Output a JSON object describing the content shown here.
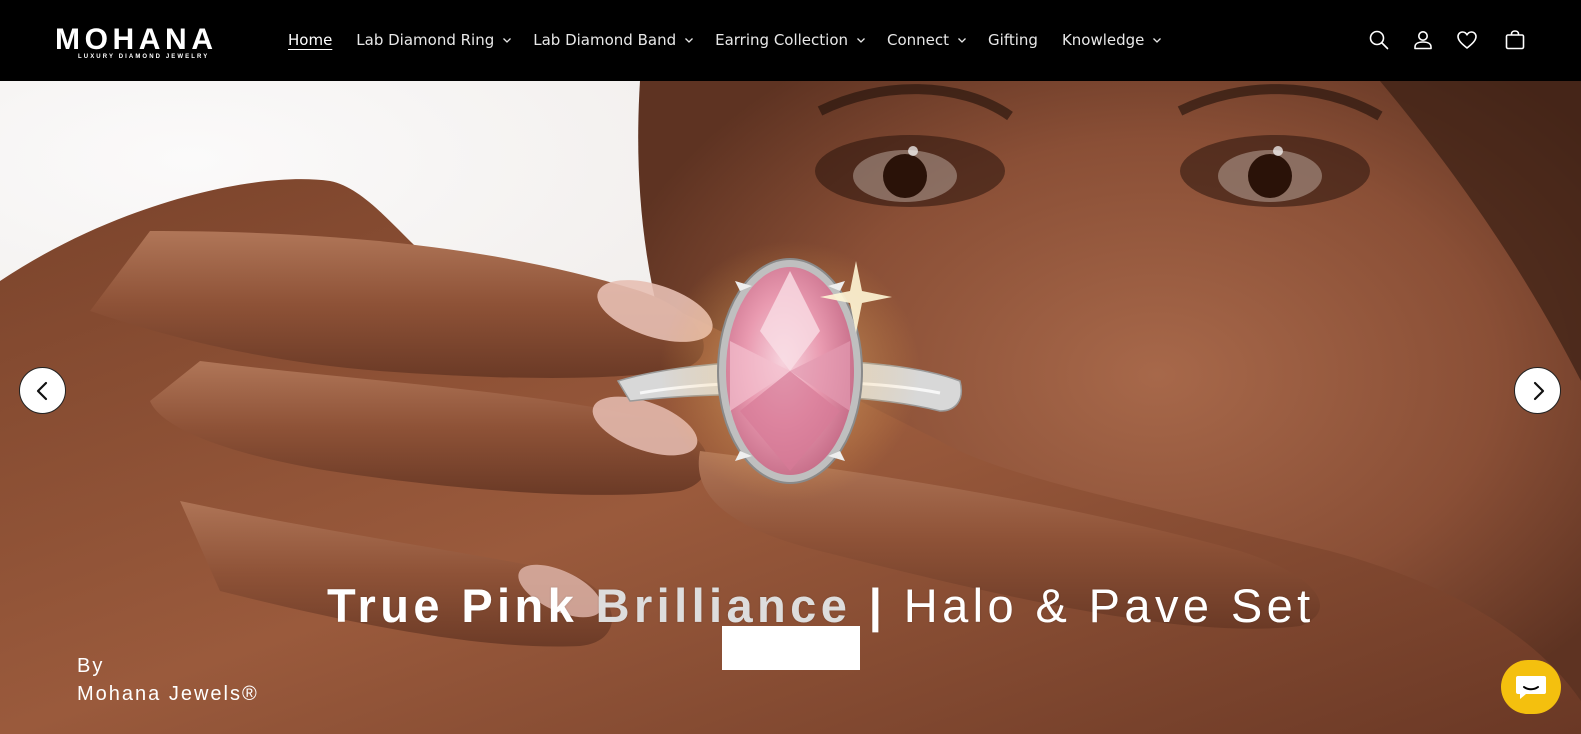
{
  "brand": {
    "name": "MOHANA",
    "tagline": "LUXURY DIAMOND JEWELRY"
  },
  "nav": {
    "items": [
      {
        "label": "Home",
        "dropdown": false,
        "active": true
      },
      {
        "label": "Lab Diamond Ring",
        "dropdown": true
      },
      {
        "label": "Lab Diamond Band",
        "dropdown": true
      },
      {
        "label": "Earring Collection",
        "dropdown": true
      },
      {
        "label": "Connect",
        "dropdown": true
      },
      {
        "label": "Gifting",
        "dropdown": false
      },
      {
        "label": "Knowledge",
        "dropdown": true
      }
    ]
  },
  "header_icons": [
    "search-icon",
    "account-icon",
    "wishlist-heart-icon",
    "cart-bag-icon"
  ],
  "hero": {
    "title_part1": "True Pink",
    "title_part2": "Brilliance",
    "title_sep": "|",
    "title_part3": "Halo & Pave Set",
    "byline_line1": "By",
    "byline_line2": "Mohana Jewels®"
  },
  "carousel": {
    "prev_icon": "chevron-left-icon",
    "next_icon": "chevron-right-icon"
  },
  "chat": {
    "icon": "chat-bubble-icon",
    "color": "#f4c00e"
  },
  "colors": {
    "header_bg": "#000000",
    "header_text": "#ffffff"
  }
}
